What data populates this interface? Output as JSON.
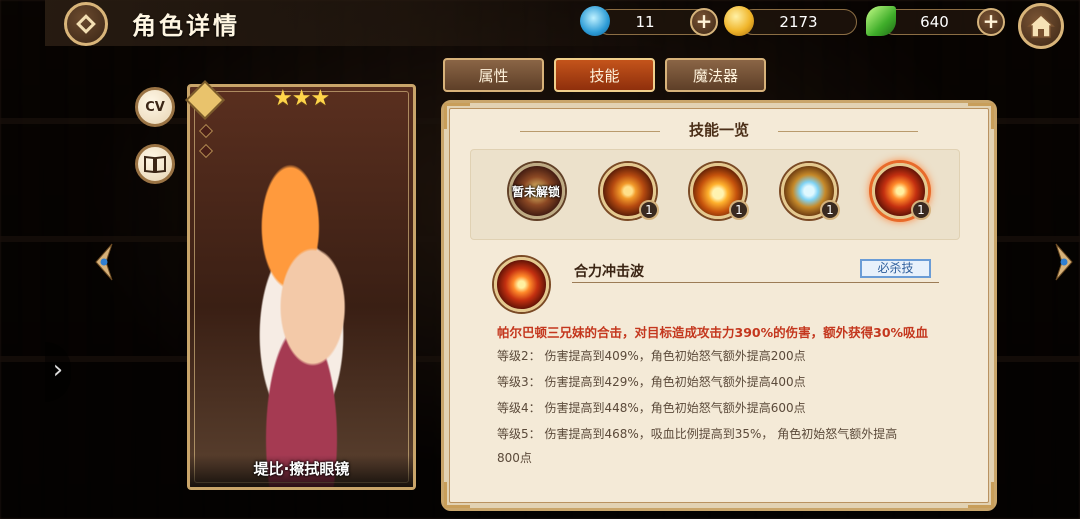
{
  "header": {
    "title": "角色详情",
    "resources": [
      {
        "icon": "shrimp-icon",
        "value": "11"
      },
      {
        "icon": "gold-coin-icon",
        "value": "2173"
      },
      {
        "icon": "green-gem-icon",
        "value": "640"
      }
    ],
    "plus_label": "+"
  },
  "side": {
    "cv_label": "CV",
    "book_icon": "book-icon"
  },
  "character": {
    "name": "堤比·擦拭眼镜",
    "stars": "★★★"
  },
  "tabs": [
    {
      "label": "属性",
      "active": false
    },
    {
      "label": "技能",
      "active": true
    },
    {
      "label": "魔法器",
      "active": false
    }
  ],
  "skills_panel": {
    "title": "技能一览",
    "skills": [
      {
        "icon": "skill-locked-icon",
        "locked_label": "暂未解锁",
        "level": ""
      },
      {
        "icon": "skill-fire-icon",
        "level": "1"
      },
      {
        "icon": "skill-orb-icon",
        "level": "1"
      },
      {
        "icon": "skill-ice-icon",
        "level": "1"
      },
      {
        "icon": "skill-burst-icon",
        "level": "1",
        "selected": true
      }
    ],
    "selected": {
      "name": "合力冲击波",
      "type": "必杀技",
      "description": "帕尔巴顿三兄妹的合击，对目标造成攻击力390%的伤害，额外获得30%吸血",
      "levels": [
        "等级2：  伤害提高到409%，角色初始怒气额外提高200点",
        "等级3：  伤害提高到429%，角色初始怒气额外提高400点",
        "等级4：  伤害提高到448%，角色初始怒气额外提高600点",
        "等级5：  伤害提高到468%，吸血比例提高到35%，  角色初始怒气额外提高",
        "800点"
      ]
    }
  },
  "colors": {
    "accent": "#c4541b",
    "desc_red": "#c4371e",
    "frame_gold": "#c9a56a"
  }
}
